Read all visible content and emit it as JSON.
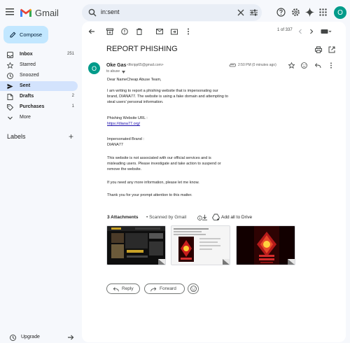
{
  "app": {
    "brand": "Gmail",
    "search_value": "in:sent",
    "avatar_initial": "O"
  },
  "sidebar": {
    "compose_label": "Compose",
    "items": [
      {
        "label": "Inbox",
        "count": "251",
        "bold": true,
        "active": false,
        "icon": "inbox-icon"
      },
      {
        "label": "Starred",
        "count": "",
        "bold": false,
        "active": false,
        "icon": "star-icon"
      },
      {
        "label": "Snoozed",
        "count": "",
        "bold": false,
        "active": false,
        "icon": "clock-icon"
      },
      {
        "label": "Sent",
        "count": "",
        "bold": true,
        "active": true,
        "icon": "send-icon"
      },
      {
        "label": "Drafts",
        "count": "2",
        "bold": true,
        "active": false,
        "icon": "draft-icon"
      },
      {
        "label": "Purchases",
        "count": "1",
        "bold": true,
        "active": false,
        "icon": "tag-icon"
      },
      {
        "label": "More",
        "count": "",
        "bold": false,
        "active": false,
        "icon": "chevron-down-icon"
      }
    ],
    "labels_heading": "Labels",
    "upgrade_label": "Upgrade"
  },
  "toolbar": {
    "pager": "1 of 337"
  },
  "email": {
    "subject": "REPORT PHISHING",
    "sender_initial": "O",
    "sender_name": "Oke Gas",
    "sender_email": "<fikripp65@gmail.com>",
    "to": "to abuse",
    "time": "2:50 PM (0 minutes ago)",
    "body": {
      "greeting": "Dear NameCheap Abuse Team,",
      "p1_l1": "I am writing to report a phishing website that is impersonating our",
      "p1_l2": "brand, DIANA77. The website is using a fake domain and attempting to",
      "p1_l3": "steal users' personal information.",
      "url_label": "Phishing Website URL :",
      "url": "https://diana77.org/",
      "brand_label": "Impersonated Brand :",
      "brand": "DIANA77",
      "p2_l1": "This website is not associated with our official services and is",
      "p2_l2": "misleading users. Please investigate and take action to suspend or",
      "p2_l3": "remove the website.",
      "p3": "If you need any more information, please let me know.",
      "p4": "Thank you for your prompt attention to this matter."
    },
    "attachments_count": "3 Attachments",
    "scanned": "• Scanned by Gmail",
    "add_all": "Add all to Drive",
    "reply_label": "Reply",
    "forward_label": "Forward"
  }
}
